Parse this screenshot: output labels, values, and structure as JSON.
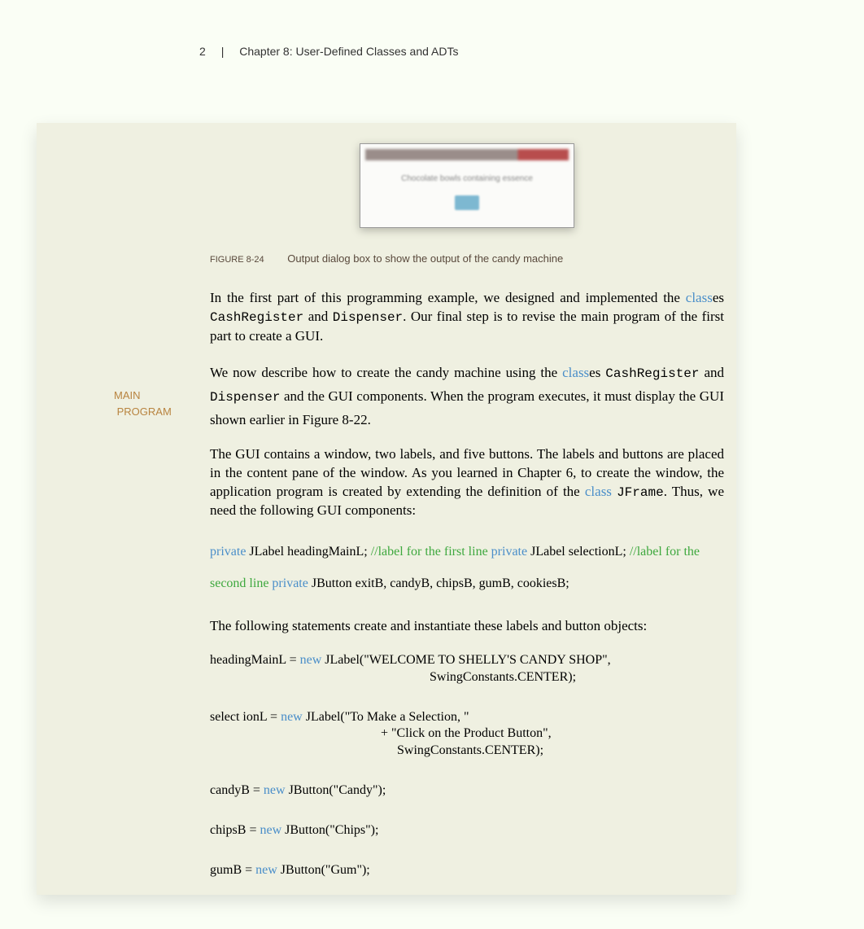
{
  "header": {
    "pagenum": "2",
    "divider": "|",
    "chapter": "Chapter 8: User-Defined Classes and ADTs"
  },
  "sidebar": {
    "label_line1": "MAIN",
    "label_line2": "PROGRAM"
  },
  "figure": {
    "label": "FIGURE 8-24",
    "caption": "Output dialog box to show the output of the candy machine",
    "dialog_text": "Chocolate bowls containing essence"
  },
  "para1": {
    "t1": "In the first part of this programming example, we designed and implemented the ",
    "kw1": "class",
    "t2": "es ",
    "cn1": "CashRegister",
    "t3": " and ",
    "cn2": "Dispenser",
    "t4": ". Our final step is to revise the main program of the first part to create a GUI."
  },
  "para2": {
    "t1": "We now describe how to create the candy machine using  the ",
    "kw1": "class",
    "t2": "es ",
    "cn1": "CashRegister",
    "t3": " and ",
    "cn2": "Dispenser",
    "t4": " and the GUI components. When the program executes, it must display the GUI shown earlier in Figure 8-22."
  },
  "para3": {
    "t1": "The GUI contains a window, two labels, and five buttons. The labels and buttons are placed in the content pane of the window. As you learned in Chapter 6, to create the window, the application program is created by extending the definition of the ",
    "kw1": "class",
    "t2": " ",
    "cn1": "JFrame",
    "t3": ". Thus, we need the following GUI components:"
  },
  "code1": {
    "kw1": "private",
    "t1": " JLabel headingMainL; ",
    "cm1": "//label for the first line",
    "t2": " ",
    "kw2": "private",
    "t3": " JLabel selectionL;      ",
    "cm2": "//label for the second line",
    "t4": " ",
    "kw3": "private",
    "t5": " JButton exitB, candyB, chipsB, gumB, cookiesB;"
  },
  "para4": "The following statements create and instantiate these labels and button objects:",
  "code_block": {
    "l1a": "headingMainL = ",
    "l1kw": "new",
    "l1b": " JLabel(\"WELCOME TO SHELLY'S CANDY SHOP\",",
    "l1c": "SwingConstants.CENTER);",
    "l2a": "select     ionL =     ",
    "l2kw": "new",
    "l2b": " JLabel(\"To Make a Selection, \"",
    "l2c": "+ \"Click on the Product Button\",",
    "l2d": "SwingConstants.CENTER);",
    "l3a": "candyB    =  ",
    "l3kw": "new",
    "l3b": "    JButton(\"Candy\");",
    "l4a": "chipsB     =  ",
    "l4kw": "new",
    "l4b": "    JButton(\"Chips\");",
    "l5a": "gumB =   ",
    "l5kw": "new",
    "l5b": " JButton(\"Gum\");"
  }
}
